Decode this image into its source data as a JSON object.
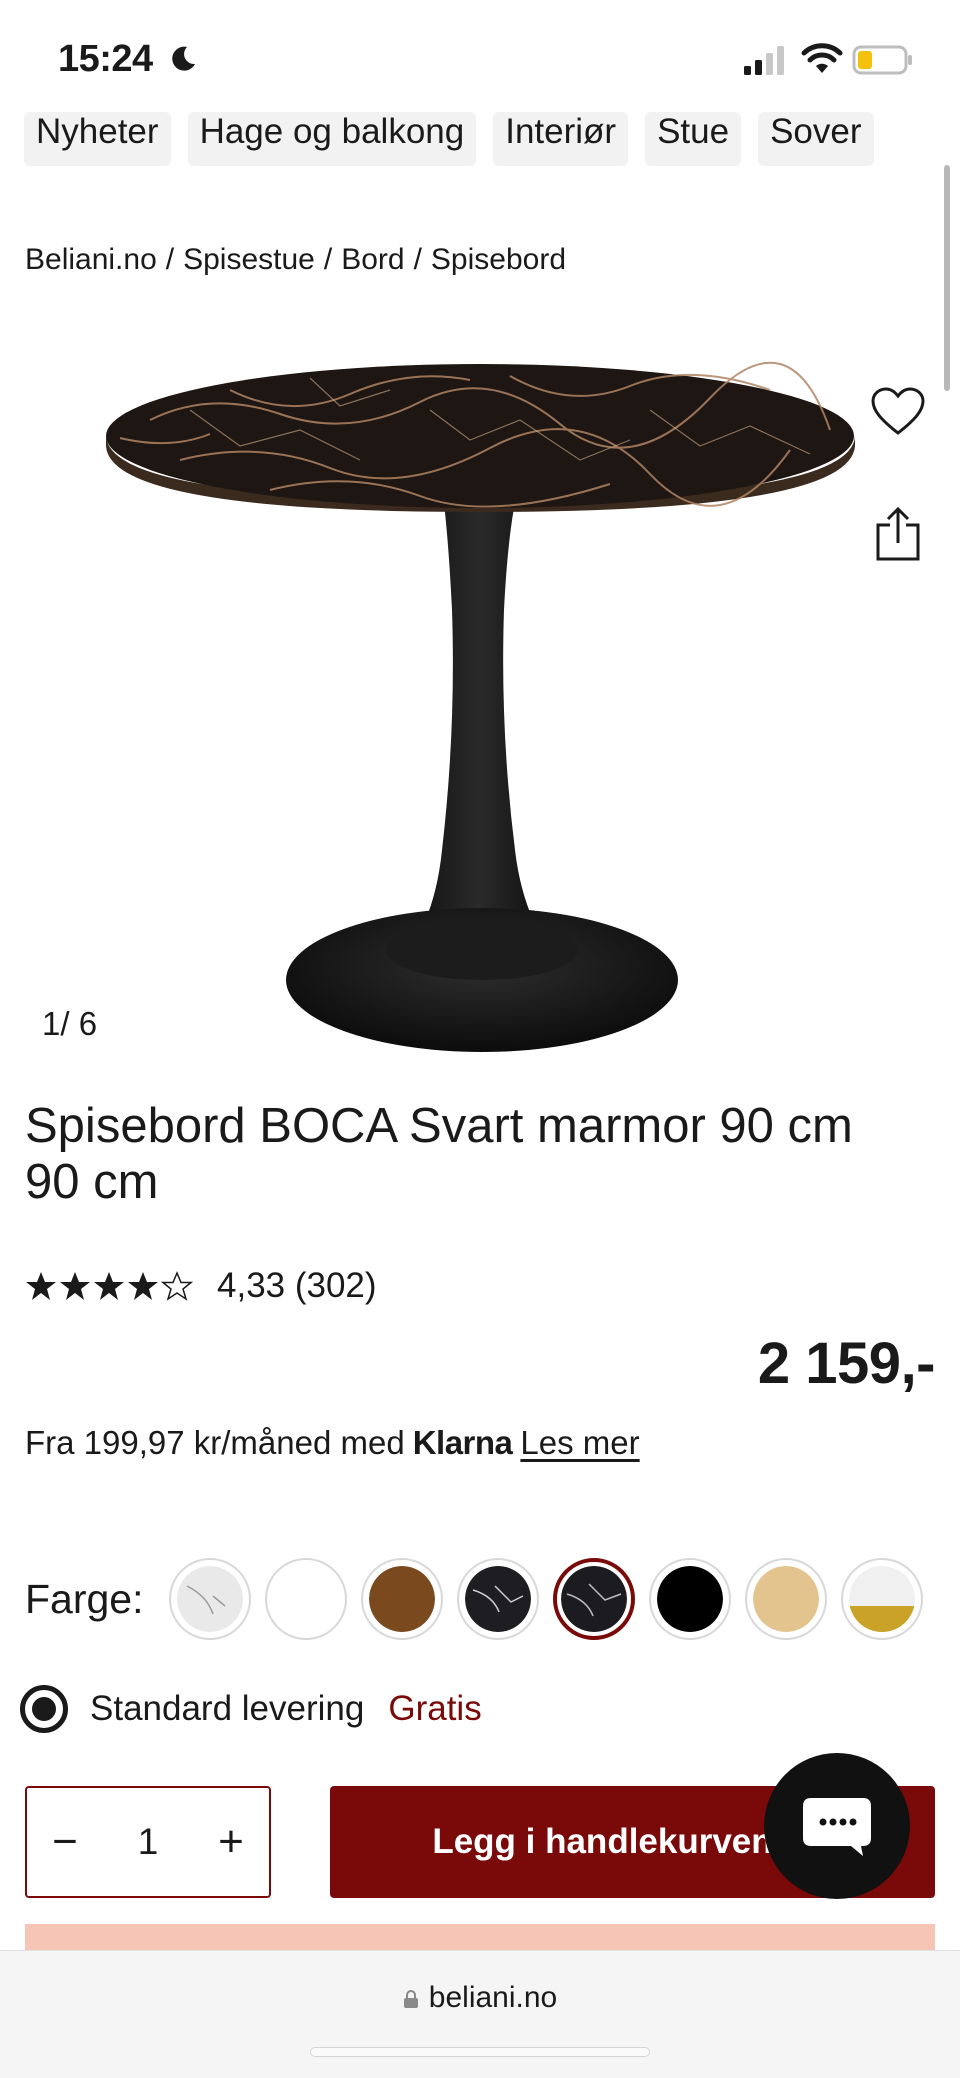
{
  "status_bar": {
    "time": "15:24"
  },
  "categories": [
    "Nyheter",
    "Hage og balkong",
    "Interiør",
    "Stue",
    "Sover"
  ],
  "breadcrumb": [
    "Beliani.no",
    "/",
    "Spisestue",
    "/",
    "Bord",
    "/",
    "Spisebord"
  ],
  "gallery": {
    "counter": "1/  6"
  },
  "product": {
    "title": "Spisebord BOCA Svart marmor 90 cm 90 cm",
    "rating_value": 4.33,
    "rating_text": "4,33 (302)",
    "price": "2 159,-"
  },
  "klarna": {
    "prefix": "Fra 199,97 kr/måned med",
    "logo": "Klarna",
    "link": "Les mer"
  },
  "color": {
    "label": "Farge:",
    "swatches": [
      {
        "name": "white-marble"
      },
      {
        "name": "white"
      },
      {
        "name": "brown-wood"
      },
      {
        "name": "black-marble-white"
      },
      {
        "name": "black-marble",
        "selected": true
      },
      {
        "name": "black"
      },
      {
        "name": "light-wood"
      },
      {
        "name": "white-marble-gold"
      }
    ]
  },
  "delivery": {
    "label": "Standard levering",
    "price": "Gratis"
  },
  "cart": {
    "minus": "−",
    "quantity": "1",
    "plus": "+",
    "button": "Legg i handlekurven"
  },
  "browser": {
    "url": "beliani.no"
  },
  "colors": {
    "accent": "#7a0a0a",
    "peach": "#f7c5b5"
  }
}
